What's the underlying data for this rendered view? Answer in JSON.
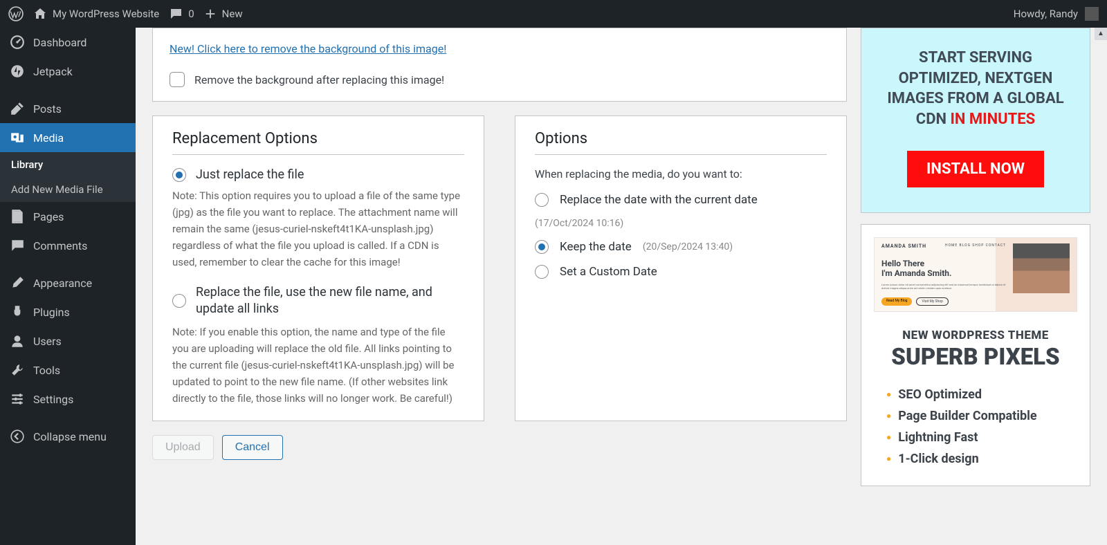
{
  "admin_bar": {
    "site_name": "My WordPress Website",
    "comment_count": "0",
    "new_label": "New",
    "greeting": "Howdy, Randy"
  },
  "sidebar": {
    "items": [
      {
        "label": "Dashboard",
        "icon": "dashboard"
      },
      {
        "label": "Jetpack",
        "icon": "jetpack"
      },
      {
        "label": "Posts",
        "icon": "pin"
      },
      {
        "label": "Media",
        "icon": "media",
        "current": true
      },
      {
        "label": "Pages",
        "icon": "pages"
      },
      {
        "label": "Comments",
        "icon": "comment"
      },
      {
        "label": "Appearance",
        "icon": "brush"
      },
      {
        "label": "Plugins",
        "icon": "plug"
      },
      {
        "label": "Users",
        "icon": "user"
      },
      {
        "label": "Tools",
        "icon": "wrench"
      },
      {
        "label": "Settings",
        "icon": "settings"
      },
      {
        "label": "Collapse menu",
        "icon": "collapse"
      }
    ],
    "submenu": [
      {
        "label": "Library",
        "current": true
      },
      {
        "label": "Add New Media File"
      }
    ]
  },
  "bg_box": {
    "link": "New! Click here to remove the background of this image!",
    "checkbox_label": "Remove the background after replacing this image!"
  },
  "replacement": {
    "title": "Replacement Options",
    "opt1_label": "Just replace the file",
    "opt1_note": "Note: This option requires you to upload a file of the same type (jpg) as the file you want to replace. The attachment name will remain the same (jesus-curiel-nskeft4t1KA-unsplash.jpg) regardless of what the file you upload is called. If a CDN is used, remember to clear the cache for this image!",
    "opt2_label": "Replace the file, use the new file name, and update all links",
    "opt2_note": "Note: If you enable this option, the name and type of the file you are uploading will replace the old file. All links pointing to the current file (jesus-curiel-nskeft4t1KA-unsplash.jpg) will be updated to point to the new file name. (If other websites link directly to the file, those links will no longer work. Be careful!)"
  },
  "options": {
    "title": "Options",
    "subtitle": "When replacing the media, do you want to:",
    "opt1_label": "Replace the date with the current date",
    "opt1_date": "(17/Oct/2024 10:16)",
    "opt2_label": "Keep the date",
    "opt2_date": "(20/Sep/2024 13:40)",
    "opt3_label": "Set a Custom Date"
  },
  "buttons": {
    "upload": "Upload",
    "cancel": "Cancel"
  },
  "promo_cdn": {
    "line1": "START SERVING OPTIMIZED, NEXTGEN IMAGES FROM A GLOBAL CDN",
    "line2": "IN MINUTES",
    "button": "INSTALL NOW"
  },
  "promo_theme": {
    "preview_name": "AMANDA SMITH",
    "preview_nav": "HOME   BLOG   SHOP   CONTACT",
    "preview_h1": "Hello There",
    "preview_h2": "I'm Amanda Smith.",
    "preview_body": "Lorem ipsum dolor sit amet consectetur adipiscing elit sed do eiusmod tempor incididunt ut labore et dolore magna aliqua enim ad minim veniam quis nostrud.",
    "preview_btn1": "Read My Blog",
    "preview_btn2": "Visit My Shop",
    "h1": "NEW WORDPRESS THEME",
    "h2": "SUPERB PIXELS",
    "features": [
      "SEO Optimized",
      "Page Builder Compatible",
      "Lightning Fast",
      "1-Click design"
    ]
  }
}
